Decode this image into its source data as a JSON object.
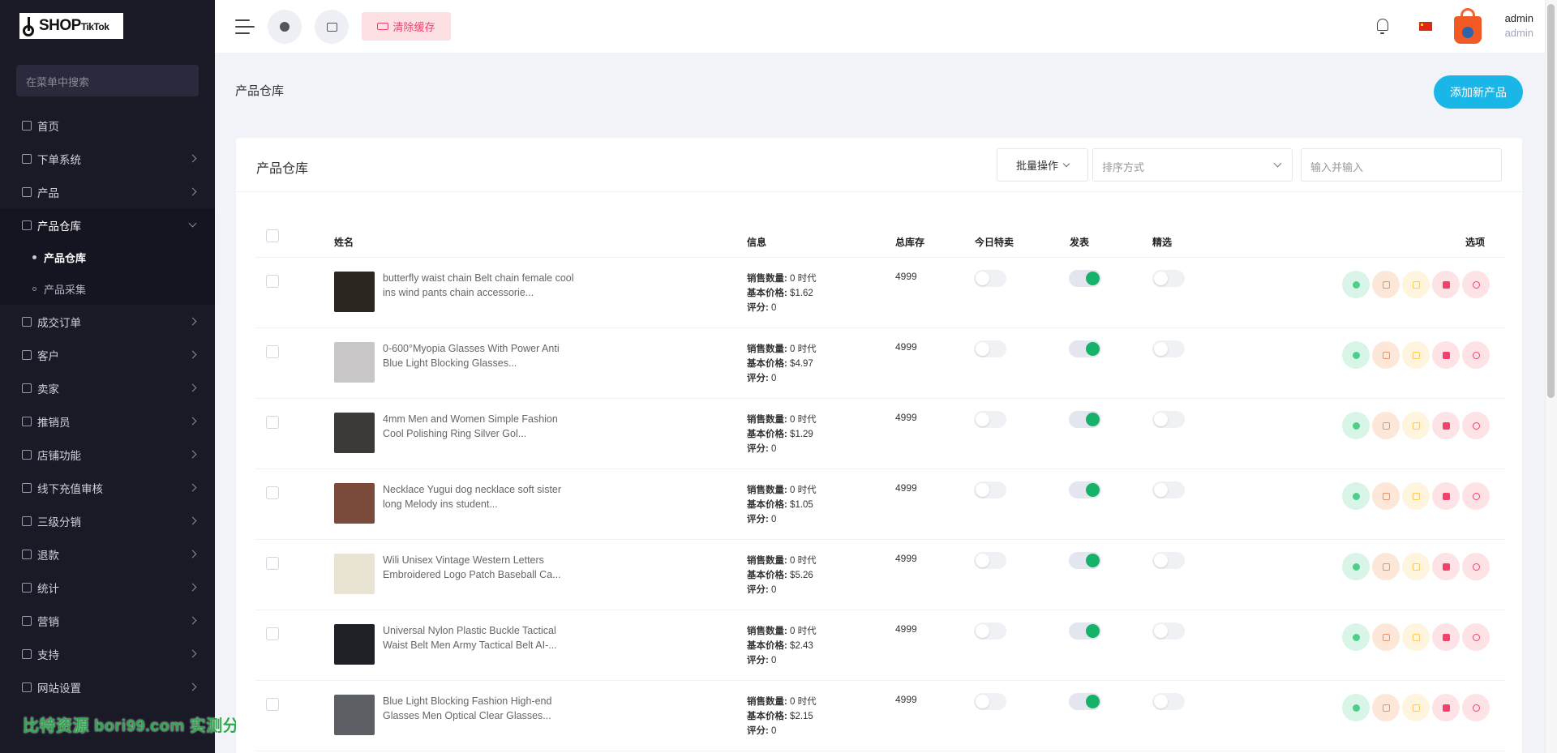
{
  "brand": {
    "logo_main": "SHOP",
    "logo_sub": "TikTok"
  },
  "sidebar": {
    "search_placeholder": "在菜单中搜索",
    "items": [
      {
        "label": "首页",
        "has_children": false
      },
      {
        "label": "下单系统",
        "has_children": true
      },
      {
        "label": "产品",
        "has_children": true
      },
      {
        "label": "产品仓库",
        "has_children": true,
        "open": true
      },
      {
        "label": "成交订单",
        "has_children": true
      },
      {
        "label": "客户",
        "has_children": true
      },
      {
        "label": "卖家",
        "has_children": true
      },
      {
        "label": "推销员",
        "has_children": true
      },
      {
        "label": "店铺功能",
        "has_children": true
      },
      {
        "label": "线下充值审核",
        "has_children": true
      },
      {
        "label": "三级分销",
        "has_children": true
      },
      {
        "label": "退款",
        "has_children": true
      },
      {
        "label": "统计",
        "has_children": true
      },
      {
        "label": "营销",
        "has_children": true
      },
      {
        "label": "支持",
        "has_children": true
      },
      {
        "label": "网站设置",
        "has_children": true
      }
    ],
    "submenu": [
      {
        "label": "产品仓库",
        "active": true
      },
      {
        "label": "产品采集",
        "active": false
      }
    ]
  },
  "watermark": "比特资源 bori99.com 实测分享",
  "header": {
    "clear_cache": "清除缓存",
    "user_name": "admin",
    "user_role": "admin",
    "icons": [
      "menu-icon",
      "globe-icon",
      "printer-icon",
      "bell-icon",
      "china-flag-icon",
      "shopping-bag-avatar"
    ]
  },
  "page": {
    "title": "产品仓库",
    "add_button": "添加新产品"
  },
  "card": {
    "title": "产品仓库",
    "bulk_action": "批量操作",
    "sort_placeholder": "排序方式",
    "search_placeholder": "输入并输入"
  },
  "table": {
    "columns": [
      "姓名",
      "信息",
      "总库存",
      "今日特卖",
      "发表",
      "精选",
      "选项"
    ],
    "info_labels": {
      "sales": "销售数量:",
      "price": "基本价格:",
      "rating": "评分:"
    },
    "rows": [
      {
        "name": "butterfly waist chain Belt chain female cool ins wind pants chain accessorie...",
        "sales": "0 时代",
        "price": "$1.62",
        "rating": "0",
        "stock": "4999",
        "today_deal": false,
        "published": true,
        "featured": false,
        "thumb_color": "#2b2620"
      },
      {
        "name": "0-600°Myopia Glasses With Power Anti Blue Light Blocking Glasses...",
        "sales": "0 时代",
        "price": "$4.97",
        "rating": "0",
        "stock": "4999",
        "today_deal": false,
        "published": true,
        "featured": false,
        "thumb_color": "#c9c6c8"
      },
      {
        "name": "4mm Men and Women Simple Fashion Cool Polishing Ring Silver Gol...",
        "sales": "0 时代",
        "price": "$1.29",
        "rating": "0",
        "stock": "4999",
        "today_deal": false,
        "published": true,
        "featured": false,
        "thumb_color": "#3c3a36"
      },
      {
        "name": "Necklace Yugui dog necklace soft sister long Melody ins student...",
        "sales": "0 时代",
        "price": "$1.05",
        "rating": "0",
        "stock": "4999",
        "today_deal": false,
        "published": true,
        "featured": false,
        "thumb_color": "#7a4a3a"
      },
      {
        "name": "Wili Unisex Vintage Western Letters Embroidered Logo Patch Baseball Ca...",
        "sales": "0 时代",
        "price": "$5.26",
        "rating": "0",
        "stock": "4999",
        "today_deal": false,
        "published": true,
        "featured": false,
        "thumb_color": "#e9e3d4"
      },
      {
        "name": "Universal Nylon Plastic Buckle Tactical Waist Belt Men Army Tactical Belt AI-...",
        "sales": "0 时代",
        "price": "$2.43",
        "rating": "0",
        "stock": "4999",
        "today_deal": false,
        "published": true,
        "featured": false,
        "thumb_color": "#1e2226"
      },
      {
        "name": "Blue Light Blocking Fashion High-end Glasses Men Optical Clear Glasses...",
        "sales": "0 时代",
        "price": "$2.15",
        "rating": "0",
        "stock": "4999",
        "today_deal": false,
        "published": true,
        "featured": false,
        "thumb_color": "#5c5f63"
      }
    ],
    "actions": [
      "view-icon",
      "edit-icon",
      "copy-icon",
      "delete-icon",
      "unpublish-icon"
    ]
  }
}
